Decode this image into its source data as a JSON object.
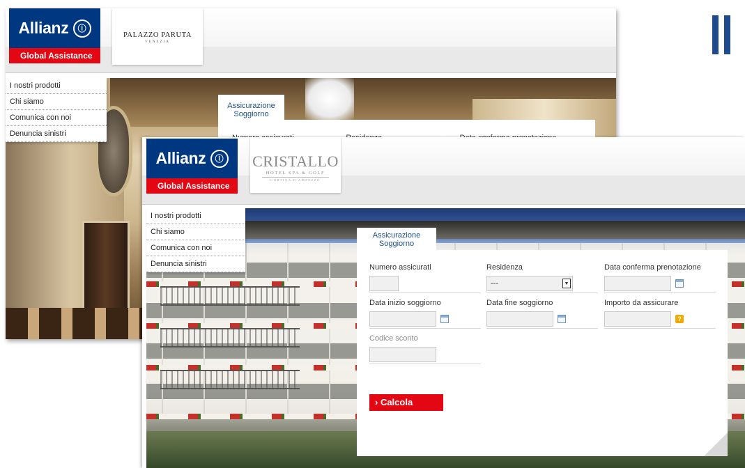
{
  "brand": {
    "name": "Allianz",
    "mark": "ⓘ",
    "tagline": "Global Assistance",
    "colors": {
      "blue": "#003781",
      "red": "#e30613",
      "tab_text": "#1a4f8b"
    }
  },
  "slide": {
    "icon": "pause-icon"
  },
  "back_window": {
    "partner": {
      "name": "PALAZZO PARUTA",
      "sub": "VENEZIA"
    },
    "menu": [
      "I nostri prodotti",
      "Chi siamo",
      "Comunica con noi",
      "Denuncia sinistri"
    ],
    "tab": "Assicurazione Soggiorno",
    "columns": [
      "Numero assicurati",
      "Residenza",
      "Data conferma prenotazione"
    ]
  },
  "front_window": {
    "partner": {
      "name": "CRISTALLO",
      "sub": "HOTEL SPA & GOLF",
      "sub2": "CORTINA D'AMPEZZO"
    },
    "menu": [
      "I nostri prodotti",
      "Chi siamo",
      "Comunica con noi",
      "Denuncia sinistri"
    ],
    "tab": "Assicurazione Soggiorno",
    "form": {
      "numero_assicurati": {
        "label": "Numero assicurati",
        "value": ""
      },
      "residenza": {
        "label": "Residenza",
        "value": "---"
      },
      "data_conferma": {
        "label": "Data conferma prenotazione",
        "value": ""
      },
      "data_inizio": {
        "label": "Data inizio soggiorno",
        "value": ""
      },
      "data_fine": {
        "label": "Data fine soggiorno",
        "value": ""
      },
      "importo": {
        "label": "Importo da assicurare",
        "value": ""
      },
      "codice_sconto": {
        "label": "Codice sconto",
        "value": ""
      },
      "calcola": "› Calcola",
      "help": "?"
    }
  }
}
